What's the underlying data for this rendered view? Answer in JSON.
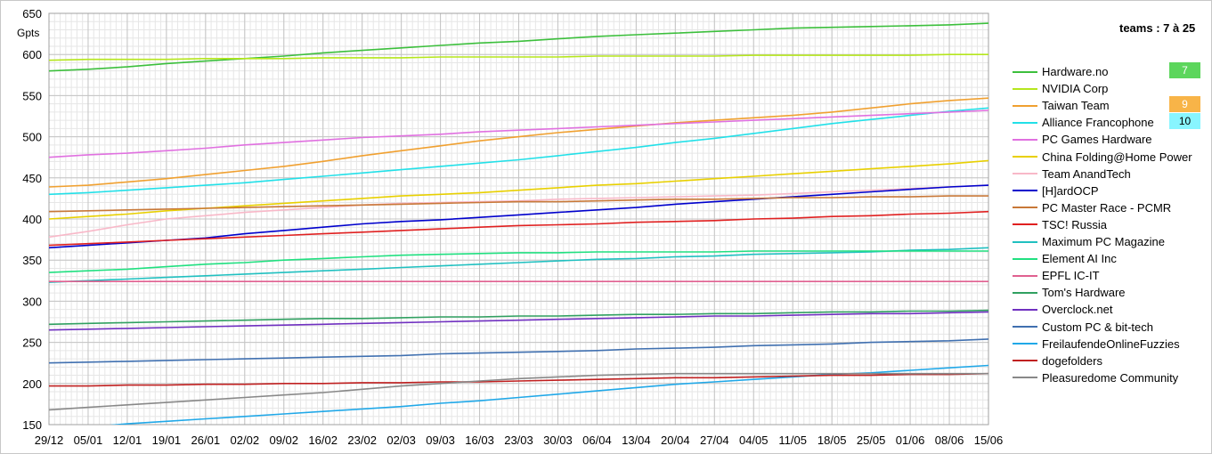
{
  "range_label": "teams : 7 à 25",
  "y_unit": "Gpts",
  "chart_data": {
    "type": "line",
    "ylim": [
      150,
      650
    ],
    "yticks": [
      150,
      200,
      250,
      300,
      350,
      400,
      450,
      500,
      550,
      600,
      650
    ],
    "x_tick_labels": [
      "29/12",
      "05/01",
      "12/01",
      "19/01",
      "26/01",
      "02/02",
      "09/02",
      "16/02",
      "23/02",
      "02/03",
      "09/03",
      "16/03",
      "23/03",
      "30/03",
      "06/04",
      "13/04",
      "20/04",
      "27/04",
      "04/05",
      "11/05",
      "18/05",
      "25/05",
      "01/06",
      "08/06",
      "15/06"
    ],
    "grid": true,
    "legend_position": "right",
    "series": [
      {
        "name": "Hardware.no",
        "color": "#3cbf3c",
        "rank": "7",
        "rank_color": "#5cd65c",
        "values": [
          580,
          582,
          585,
          589,
          592,
          595,
          598,
          602,
          605,
          608,
          611,
          614,
          616,
          619,
          622,
          624,
          626,
          628,
          630,
          632,
          633,
          634,
          635,
          636,
          638
        ]
      },
      {
        "name": "NVIDIA Corp",
        "color": "#b5e61d",
        "values": [
          593,
          594,
          594,
          594,
          595,
          595,
          595,
          596,
          596,
          596,
          597,
          597,
          597,
          597,
          598,
          598,
          598,
          598,
          599,
          599,
          599,
          599,
          599,
          600,
          600
        ]
      },
      {
        "name": "Taiwan Team",
        "color": "#f0a030",
        "rank": "9",
        "rank_color": "#f8b448",
        "values": [
          439,
          441,
          445,
          449,
          454,
          459,
          464,
          470,
          477,
          483,
          489,
          495,
          500,
          505,
          509,
          513,
          517,
          520,
          523,
          526,
          530,
          535,
          540,
          544,
          547
        ]
      },
      {
        "name": "Alliance Francophone",
        "color": "#22e0e8",
        "rank": "10",
        "rank_color": "#88f5ff",
        "values": [
          430,
          432,
          435,
          438,
          441,
          444,
          448,
          452,
          456,
          460,
          464,
          468,
          472,
          477,
          482,
          487,
          493,
          498,
          504,
          510,
          516,
          521,
          526,
          531,
          535
        ]
      },
      {
        "name": "PC Games Hardware",
        "color": "#e070e0",
        "values": [
          475,
          478,
          480,
          483,
          486,
          490,
          493,
          496,
          499,
          501,
          503,
          506,
          508,
          510,
          512,
          514,
          516,
          518,
          520,
          522,
          524,
          526,
          528,
          530,
          532
        ]
      },
      {
        "name": "China Folding@Home Power",
        "color": "#e8d000",
        "values": [
          400,
          403,
          406,
          410,
          413,
          416,
          419,
          422,
          425,
          428,
          430,
          432,
          435,
          438,
          441,
          443,
          446,
          449,
          452,
          455,
          458,
          461,
          464,
          467,
          471
        ]
      },
      {
        "name": "Team AnandTech",
        "color": "#f8b8c8",
        "values": [
          378,
          385,
          393,
          400,
          404,
          408,
          411,
          414,
          417,
          419,
          420,
          421,
          422,
          424,
          425,
          426,
          427,
          428,
          429,
          431,
          433,
          435,
          437,
          439,
          441
        ]
      },
      {
        "name": "[H]ardOCP",
        "color": "#0000cc",
        "values": [
          365,
          368,
          371,
          374,
          377,
          382,
          386,
          390,
          394,
          397,
          399,
          402,
          405,
          408,
          411,
          414,
          418,
          421,
          424,
          427,
          430,
          433,
          436,
          439,
          441
        ]
      },
      {
        "name": "PC Master Race - PCMR",
        "color": "#c87838",
        "values": [
          409,
          410,
          411,
          412,
          413,
          414,
          415,
          416,
          417,
          418,
          419,
          420,
          421,
          421,
          422,
          423,
          424,
          424,
          425,
          426,
          426,
          427,
          427,
          428,
          428
        ]
      },
      {
        "name": "TSC! Russia",
        "color": "#e02020",
        "values": [
          368,
          370,
          372,
          374,
          376,
          378,
          380,
          382,
          384,
          386,
          388,
          390,
          392,
          393,
          394,
          396,
          397,
          398,
          400,
          401,
          403,
          404,
          406,
          407,
          409
        ]
      },
      {
        "name": "Maximum PC Magazine",
        "color": "#20c0c0",
        "values": [
          323,
          325,
          327,
          329,
          331,
          333,
          335,
          337,
          339,
          341,
          343,
          345,
          347,
          349,
          351,
          352,
          354,
          355,
          357,
          358,
          359,
          360,
          362,
          363,
          365
        ]
      },
      {
        "name": "Element AI Inc",
        "color": "#20e080",
        "values": [
          335,
          337,
          339,
          342,
          345,
          347,
          350,
          352,
          354,
          356,
          357,
          358,
          359,
          359,
          360,
          360,
          360,
          360,
          361,
          361,
          361,
          361,
          361,
          361,
          361
        ]
      },
      {
        "name": "EPFL IC-IT",
        "color": "#e06090",
        "values": [
          324,
          324,
          324,
          324,
          324,
          324,
          324,
          324,
          324,
          324,
          324,
          324,
          324,
          324,
          324,
          324,
          324,
          324,
          324,
          324,
          324,
          324,
          324,
          324,
          324
        ]
      },
      {
        "name": "Tom's Hardware",
        "color": "#30a060",
        "values": [
          272,
          273,
          274,
          275,
          276,
          277,
          278,
          279,
          279,
          280,
          281,
          281,
          282,
          282,
          283,
          284,
          284,
          285,
          285,
          286,
          287,
          287,
          288,
          288,
          289
        ]
      },
      {
        "name": "Overclock.net",
        "color": "#7030c0",
        "values": [
          265,
          266,
          267,
          268,
          269,
          270,
          271,
          272,
          273,
          274,
          275,
          276,
          277,
          278,
          279,
          280,
          281,
          282,
          282,
          283,
          284,
          285,
          285,
          286,
          287
        ]
      },
      {
        "name": "Custom PC & bit-tech",
        "color": "#4070b0",
        "values": [
          225,
          226,
          227,
          228,
          229,
          230,
          231,
          232,
          233,
          234,
          236,
          237,
          238,
          239,
          240,
          242,
          243,
          244,
          246,
          247,
          248,
          250,
          251,
          252,
          254
        ]
      },
      {
        "name": "FreilaufendeOnlineFuzzies",
        "color": "#20a8e8",
        "values": [
          144,
          147,
          151,
          154,
          157,
          160,
          163,
          166,
          169,
          172,
          176,
          179,
          183,
          187,
          191,
          195,
          199,
          202,
          205,
          208,
          211,
          213,
          216,
          219,
          222
        ]
      },
      {
        "name": "dogefolders",
        "color": "#c02020",
        "values": [
          197,
          197,
          198,
          198,
          199,
          199,
          200,
          200,
          201,
          201,
          202,
          202,
          203,
          204,
          205,
          206,
          207,
          207,
          208,
          209,
          210,
          210,
          211,
          211,
          212
        ]
      },
      {
        "name": "Pleasuredome Community",
        "color": "#888888",
        "values": [
          168,
          171,
          174,
          177,
          180,
          183,
          186,
          189,
          193,
          197,
          200,
          203,
          206,
          208,
          210,
          211,
          212,
          212,
          212,
          212,
          212,
          212,
          212,
          212,
          212
        ]
      }
    ]
  }
}
